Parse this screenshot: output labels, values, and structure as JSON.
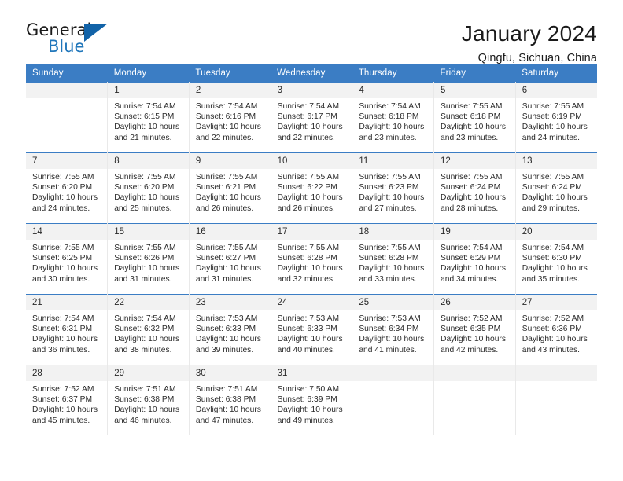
{
  "brand": {
    "name_top": "General",
    "name_bottom": "Blue",
    "accent_color": "#1263a8",
    "text_color": "#1b1b1b"
  },
  "header": {
    "title": "January 2024",
    "subtitle": "Qingfu, Sichuan, China"
  },
  "calendar": {
    "header_color": "#3b7dc4",
    "weekday_headers": [
      "Sunday",
      "Monday",
      "Tuesday",
      "Wednesday",
      "Thursday",
      "Friday",
      "Saturday"
    ],
    "weeks": [
      [
        {
          "day": "",
          "sunrise": "",
          "sunset": "",
          "daylight1": "",
          "daylight2": ""
        },
        {
          "day": "1",
          "sunrise": "Sunrise: 7:54 AM",
          "sunset": "Sunset: 6:15 PM",
          "daylight1": "Daylight: 10 hours",
          "daylight2": "and 21 minutes."
        },
        {
          "day": "2",
          "sunrise": "Sunrise: 7:54 AM",
          "sunset": "Sunset: 6:16 PM",
          "daylight1": "Daylight: 10 hours",
          "daylight2": "and 22 minutes."
        },
        {
          "day": "3",
          "sunrise": "Sunrise: 7:54 AM",
          "sunset": "Sunset: 6:17 PM",
          "daylight1": "Daylight: 10 hours",
          "daylight2": "and 22 minutes."
        },
        {
          "day": "4",
          "sunrise": "Sunrise: 7:54 AM",
          "sunset": "Sunset: 6:18 PM",
          "daylight1": "Daylight: 10 hours",
          "daylight2": "and 23 minutes."
        },
        {
          "day": "5",
          "sunrise": "Sunrise: 7:55 AM",
          "sunset": "Sunset: 6:18 PM",
          "daylight1": "Daylight: 10 hours",
          "daylight2": "and 23 minutes."
        },
        {
          "day": "6",
          "sunrise": "Sunrise: 7:55 AM",
          "sunset": "Sunset: 6:19 PM",
          "daylight1": "Daylight: 10 hours",
          "daylight2": "and 24 minutes."
        }
      ],
      [
        {
          "day": "7",
          "sunrise": "Sunrise: 7:55 AM",
          "sunset": "Sunset: 6:20 PM",
          "daylight1": "Daylight: 10 hours",
          "daylight2": "and 24 minutes."
        },
        {
          "day": "8",
          "sunrise": "Sunrise: 7:55 AM",
          "sunset": "Sunset: 6:20 PM",
          "daylight1": "Daylight: 10 hours",
          "daylight2": "and 25 minutes."
        },
        {
          "day": "9",
          "sunrise": "Sunrise: 7:55 AM",
          "sunset": "Sunset: 6:21 PM",
          "daylight1": "Daylight: 10 hours",
          "daylight2": "and 26 minutes."
        },
        {
          "day": "10",
          "sunrise": "Sunrise: 7:55 AM",
          "sunset": "Sunset: 6:22 PM",
          "daylight1": "Daylight: 10 hours",
          "daylight2": "and 26 minutes."
        },
        {
          "day": "11",
          "sunrise": "Sunrise: 7:55 AM",
          "sunset": "Sunset: 6:23 PM",
          "daylight1": "Daylight: 10 hours",
          "daylight2": "and 27 minutes."
        },
        {
          "day": "12",
          "sunrise": "Sunrise: 7:55 AM",
          "sunset": "Sunset: 6:24 PM",
          "daylight1": "Daylight: 10 hours",
          "daylight2": "and 28 minutes."
        },
        {
          "day": "13",
          "sunrise": "Sunrise: 7:55 AM",
          "sunset": "Sunset: 6:24 PM",
          "daylight1": "Daylight: 10 hours",
          "daylight2": "and 29 minutes."
        }
      ],
      [
        {
          "day": "14",
          "sunrise": "Sunrise: 7:55 AM",
          "sunset": "Sunset: 6:25 PM",
          "daylight1": "Daylight: 10 hours",
          "daylight2": "and 30 minutes."
        },
        {
          "day": "15",
          "sunrise": "Sunrise: 7:55 AM",
          "sunset": "Sunset: 6:26 PM",
          "daylight1": "Daylight: 10 hours",
          "daylight2": "and 31 minutes."
        },
        {
          "day": "16",
          "sunrise": "Sunrise: 7:55 AM",
          "sunset": "Sunset: 6:27 PM",
          "daylight1": "Daylight: 10 hours",
          "daylight2": "and 31 minutes."
        },
        {
          "day": "17",
          "sunrise": "Sunrise: 7:55 AM",
          "sunset": "Sunset: 6:28 PM",
          "daylight1": "Daylight: 10 hours",
          "daylight2": "and 32 minutes."
        },
        {
          "day": "18",
          "sunrise": "Sunrise: 7:55 AM",
          "sunset": "Sunset: 6:28 PM",
          "daylight1": "Daylight: 10 hours",
          "daylight2": "and 33 minutes."
        },
        {
          "day": "19",
          "sunrise": "Sunrise: 7:54 AM",
          "sunset": "Sunset: 6:29 PM",
          "daylight1": "Daylight: 10 hours",
          "daylight2": "and 34 minutes."
        },
        {
          "day": "20",
          "sunrise": "Sunrise: 7:54 AM",
          "sunset": "Sunset: 6:30 PM",
          "daylight1": "Daylight: 10 hours",
          "daylight2": "and 35 minutes."
        }
      ],
      [
        {
          "day": "21",
          "sunrise": "Sunrise: 7:54 AM",
          "sunset": "Sunset: 6:31 PM",
          "daylight1": "Daylight: 10 hours",
          "daylight2": "and 36 minutes."
        },
        {
          "day": "22",
          "sunrise": "Sunrise: 7:54 AM",
          "sunset": "Sunset: 6:32 PM",
          "daylight1": "Daylight: 10 hours",
          "daylight2": "and 38 minutes."
        },
        {
          "day": "23",
          "sunrise": "Sunrise: 7:53 AM",
          "sunset": "Sunset: 6:33 PM",
          "daylight1": "Daylight: 10 hours",
          "daylight2": "and 39 minutes."
        },
        {
          "day": "24",
          "sunrise": "Sunrise: 7:53 AM",
          "sunset": "Sunset: 6:33 PM",
          "daylight1": "Daylight: 10 hours",
          "daylight2": "and 40 minutes."
        },
        {
          "day": "25",
          "sunrise": "Sunrise: 7:53 AM",
          "sunset": "Sunset: 6:34 PM",
          "daylight1": "Daylight: 10 hours",
          "daylight2": "and 41 minutes."
        },
        {
          "day": "26",
          "sunrise": "Sunrise: 7:52 AM",
          "sunset": "Sunset: 6:35 PM",
          "daylight1": "Daylight: 10 hours",
          "daylight2": "and 42 minutes."
        },
        {
          "day": "27",
          "sunrise": "Sunrise: 7:52 AM",
          "sunset": "Sunset: 6:36 PM",
          "daylight1": "Daylight: 10 hours",
          "daylight2": "and 43 minutes."
        }
      ],
      [
        {
          "day": "28",
          "sunrise": "Sunrise: 7:52 AM",
          "sunset": "Sunset: 6:37 PM",
          "daylight1": "Daylight: 10 hours",
          "daylight2": "and 45 minutes."
        },
        {
          "day": "29",
          "sunrise": "Sunrise: 7:51 AM",
          "sunset": "Sunset: 6:38 PM",
          "daylight1": "Daylight: 10 hours",
          "daylight2": "and 46 minutes."
        },
        {
          "day": "30",
          "sunrise": "Sunrise: 7:51 AM",
          "sunset": "Sunset: 6:38 PM",
          "daylight1": "Daylight: 10 hours",
          "daylight2": "and 47 minutes."
        },
        {
          "day": "31",
          "sunrise": "Sunrise: 7:50 AM",
          "sunset": "Sunset: 6:39 PM",
          "daylight1": "Daylight: 10 hours",
          "daylight2": "and 49 minutes."
        },
        {
          "day": "",
          "sunrise": "",
          "sunset": "",
          "daylight1": "",
          "daylight2": ""
        },
        {
          "day": "",
          "sunrise": "",
          "sunset": "",
          "daylight1": "",
          "daylight2": ""
        },
        {
          "day": "",
          "sunrise": "",
          "sunset": "",
          "daylight1": "",
          "daylight2": ""
        }
      ]
    ]
  }
}
